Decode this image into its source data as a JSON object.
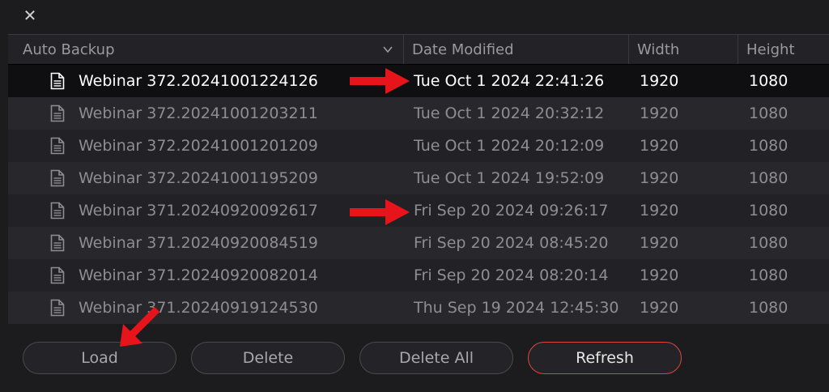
{
  "dialog": {
    "close_label": "✕"
  },
  "table": {
    "columns": {
      "name": "Auto Backup",
      "date": "Date Modified",
      "width": "Width",
      "height": "Height"
    },
    "rows": [
      {
        "name": "Webinar 372.20241001224126",
        "date": "Tue Oct 1 2024 22:41:26",
        "width": "1920",
        "height": "1080",
        "selected": true
      },
      {
        "name": "Webinar 372.20241001203211",
        "date": "Tue Oct 1 2024 20:32:12",
        "width": "1920",
        "height": "1080",
        "selected": false
      },
      {
        "name": "Webinar 372.20241001201209",
        "date": "Tue Oct 1 2024 20:12:09",
        "width": "1920",
        "height": "1080",
        "selected": false
      },
      {
        "name": "Webinar 372.20241001195209",
        "date": "Tue Oct 1 2024 19:52:09",
        "width": "1920",
        "height": "1080",
        "selected": false
      },
      {
        "name": "Webinar 371.20240920092617",
        "date": "Fri Sep 20 2024 09:26:17",
        "width": "1920",
        "height": "1080",
        "selected": false
      },
      {
        "name": "Webinar 371.20240920084519",
        "date": "Fri Sep 20 2024 08:45:20",
        "width": "1920",
        "height": "1080",
        "selected": false
      },
      {
        "name": "Webinar 371.20240920082014",
        "date": "Fri Sep 20 2024 08:20:14",
        "width": "1920",
        "height": "1080",
        "selected": false
      },
      {
        "name": "Webinar 371.20240919124530",
        "date": "Thu Sep 19 2024 12:45:30",
        "width": "1920",
        "height": "1080",
        "selected": false
      }
    ]
  },
  "buttons": {
    "load": "Load",
    "delete": "Delete",
    "delete_all": "Delete All",
    "refresh": "Refresh"
  },
  "colors": {
    "accent_red": "#e0463c",
    "annotation_arrow": "#e8141c",
    "selected_row": "#0f0f11"
  },
  "icons": {
    "close": "close-icon",
    "sort": "chevron-down-icon",
    "file": "document-icon",
    "annotation": "red-arrow-icon"
  }
}
